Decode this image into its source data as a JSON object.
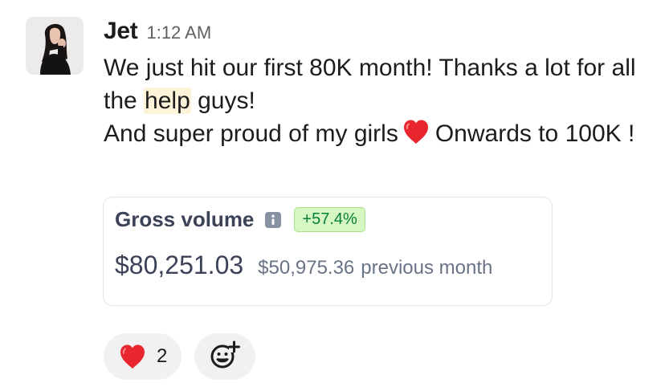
{
  "author": "Jet",
  "timestamp": "1:12 AM",
  "message": {
    "line1_before": "We just hit our first 80K month! Thanks a lot for all the ",
    "highlight": "help",
    "line1_after": " guys!",
    "line2_before": "And super proud of my girls",
    "line2_after": "Onwards to 100K !"
  },
  "card": {
    "label": "Gross volume",
    "change": "+57.4%",
    "amount": "$80,251.03",
    "previous_amount": "$50,975.36",
    "previous_label": "previous month"
  },
  "reactions": [
    {
      "emoji": "heart",
      "count": "2"
    }
  ],
  "icons": {
    "info": "info-icon",
    "add_reaction": "add-reaction-icon"
  },
  "colors": {
    "badge_text": "#05803d",
    "badge_bg": "#d7f7c2",
    "heart": "#e8262d",
    "highlight": "#fdf3d8"
  }
}
